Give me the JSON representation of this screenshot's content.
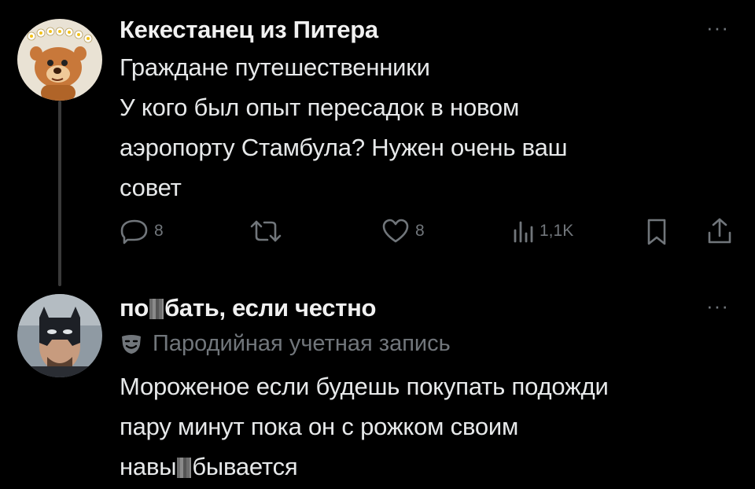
{
  "post": {
    "author_name": "Кекестанец из Питера",
    "more_label": "···",
    "text_lines": [
      "Граждане путешественники",
      "У кого был опыт пересадок в новом",
      "аэропорту Стамбула? Нужен очень ваш",
      "совет"
    ],
    "actions": {
      "replies": "8",
      "reposts": "",
      "likes": "8",
      "views": "1,1K"
    }
  },
  "reply": {
    "author_name_part1": "по",
    "author_name_part2": "бать, если честно",
    "more_label": "···",
    "parody_label": "Пародийная учетная запись",
    "text_lines": [
      "Мороженое если будешь покупать подожди",
      "пару минут пока он с рожком своим"
    ],
    "text_line3_part1": "навы",
    "text_line3_part2": "бывается"
  },
  "icons": {
    "reply": "speech-bubble-icon",
    "repost": "repost-arrows-icon",
    "like": "heart-icon",
    "views": "bar-chart-icon",
    "bookmark": "bookmark-icon",
    "share": "share-icon",
    "parody": "theater-mask-icon"
  }
}
